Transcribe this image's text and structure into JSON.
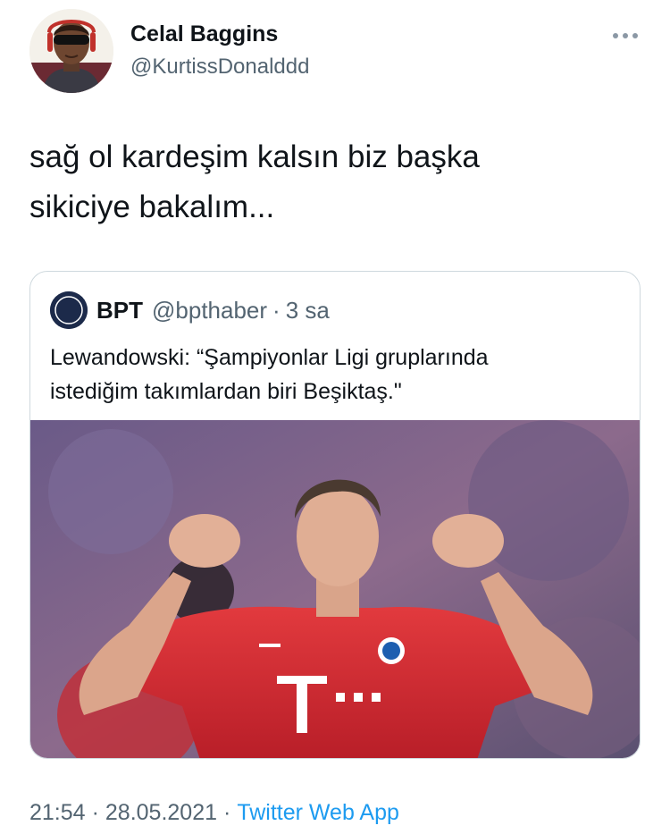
{
  "author": {
    "name": "Celal Baggins",
    "handle": "@KurtissDonalddd",
    "avatar_icon": "profile-photo"
  },
  "tweet": {
    "text": "sağ ol kardeşim kalsın biz başka\nsikiciye bakalım..."
  },
  "quoted_tweet": {
    "avatar_label": "BPT",
    "name": "BPT",
    "handle": "@bpthaber",
    "separator": "·",
    "time": "3 sa",
    "text": "Lewandowski: “Şampiyonlar Ligi gruplarında\nistediğim takımlardan biri Beşiktaş.\"",
    "image_icon": "football-player-photo",
    "jersey_sponsor_letter": "T"
  },
  "footer": {
    "time": "21:54",
    "separator": "·",
    "date": "28.05.2021",
    "source": "Twitter Web App"
  },
  "colors": {
    "text_primary": "#0f1419",
    "text_secondary": "#536471",
    "link": "#1d9bf0",
    "card_border": "#cfd9de",
    "jersey_red": "#d3252f"
  }
}
